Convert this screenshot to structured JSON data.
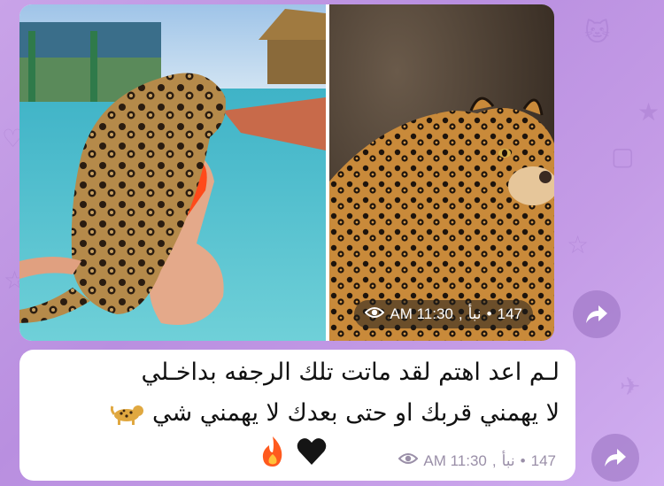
{
  "media_message": {
    "views": "147",
    "separator": "•",
    "author": "نبأ",
    "comma": ",",
    "time": "AM 11:30",
    "photos": [
      "jaguar-hug-photo",
      "leopard-portrait-photo"
    ]
  },
  "text_message": {
    "line1": "لـم اعد اهتم  لقد ماتت تلك الرجفه بداخـلي",
    "line2": "لا يهمني قربك او حتى بعدك لا يهمني شي",
    "views": "147",
    "separator": "•",
    "author": "نبأ",
    "comma": ",",
    "time": "AM 11:30",
    "reactions": [
      "black-heart-icon",
      "fire-icon"
    ],
    "trailing_emoji": "leopard-icon"
  },
  "colors": {
    "background": "#c49be6",
    "bubble": "#ffffff",
    "meta_text": "#9a8fa8",
    "share_button": "#9a6ebe"
  },
  "icons": [
    "eye-icon",
    "share-icon"
  ]
}
